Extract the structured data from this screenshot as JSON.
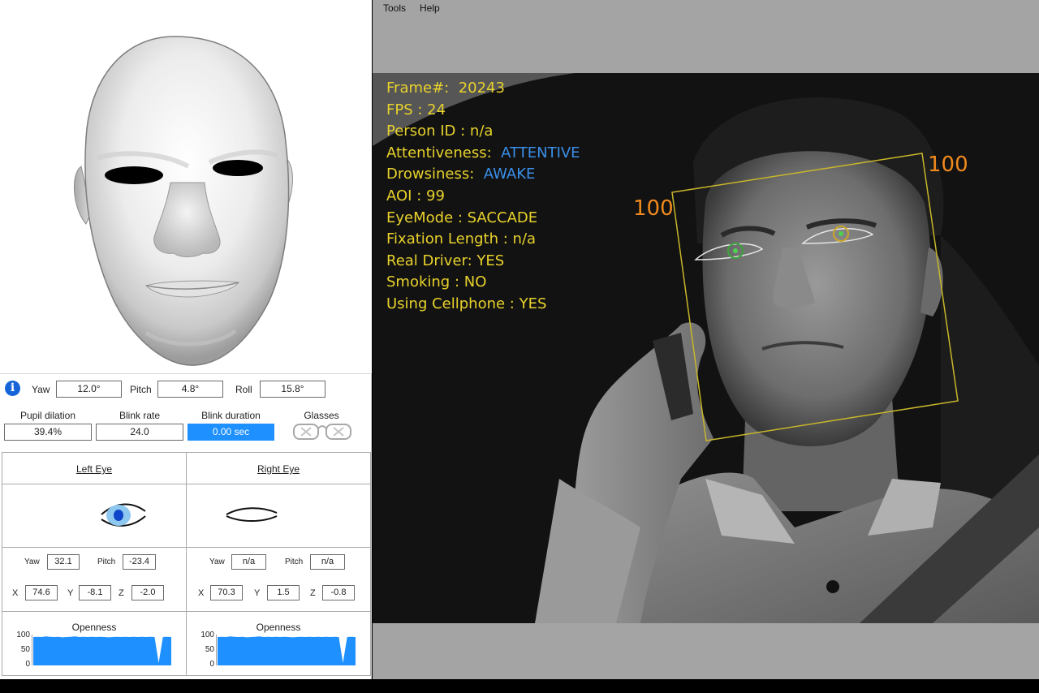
{
  "menu": {
    "tools": "Tools",
    "help": "Help"
  },
  "head_pose": {
    "yaw_label": "Yaw",
    "yaw": "12.0°",
    "pitch_label": "Pitch",
    "pitch": "4.8°",
    "roll_label": "Roll",
    "roll": "15.8°"
  },
  "metrics": {
    "pupil_label": "Pupil dilation",
    "pupil": "39.4%",
    "blink_rate_label": "Blink rate",
    "blink_rate": "24.0",
    "blink_duration_label": "Blink duration",
    "blink_duration": "0.00 sec",
    "glasses_label": "Glasses"
  },
  "left_eye": {
    "title": "Left  Eye",
    "yaw_label": "Yaw",
    "yaw": "32.1",
    "pitch_label": "Pitch",
    "pitch": "-23.4",
    "x_label": "X",
    "x": "74.6",
    "y_label": "Y",
    "y": "-8.1",
    "z_label": "Z",
    "z": "-2.0",
    "openness_title": "Openness",
    "openness_ticks": [
      "100",
      "50",
      "0"
    ],
    "openness_series": [
      92,
      93,
      92,
      94,
      93,
      92,
      93,
      91,
      92,
      93,
      94,
      92,
      93,
      92,
      93,
      92,
      93,
      92,
      91,
      92,
      93,
      92,
      93,
      92,
      93,
      92,
      93,
      92,
      93,
      92,
      8,
      92,
      93,
      92
    ],
    "state": "open"
  },
  "right_eye": {
    "title": "Right  Eye",
    "yaw_label": "Yaw",
    "yaw": "n/a",
    "pitch_label": "Pitch",
    "pitch": "n/a",
    "x_label": "X",
    "x": "70.3",
    "y_label": "Y",
    "y": "1.5",
    "z_label": "Z",
    "z": "-0.8",
    "openness_title": "Openness",
    "openness_ticks": [
      "100",
      "50",
      "0"
    ],
    "openness_series": [
      92,
      93,
      92,
      94,
      93,
      92,
      93,
      91,
      92,
      93,
      94,
      92,
      93,
      92,
      93,
      92,
      93,
      92,
      91,
      92,
      93,
      92,
      93,
      92,
      93,
      92,
      93,
      92,
      93,
      92,
      8,
      92,
      93,
      92
    ],
    "state": "closed"
  },
  "overlay": {
    "frame_label": "Frame#:",
    "frame": "20243",
    "fps_label": "FPS :",
    "fps": "24",
    "person_label": "Person ID :",
    "person": "n/a",
    "attentiveness_label": "Attentiveness:",
    "attentiveness": "ATTENTIVE",
    "drowsiness_label": "Drowsiness:",
    "drowsiness": "AWAKE",
    "aoi_label": "AOI :",
    "aoi": "99",
    "eyemode_label": "EyeMode :",
    "eyemode": "SACCADE",
    "fixation_label": "Fixation Length :",
    "fixation": "n/a",
    "real_driver_label": "Real Driver:",
    "real_driver": "YES",
    "smoking_label": "Smoking :",
    "smoking": "NO",
    "cellphone_label": "Using Cellphone :",
    "cellphone": "YES",
    "box_label_left": "100",
    "box_label_right": "100"
  },
  "colors": {
    "accent": "#1e90ff",
    "overlay_text": "#e8d22c",
    "overlay_status": "#3a8fe8",
    "box_label": "#f08a1c",
    "face_box": "#c9b62a",
    "eye_iris": "#3aa43a"
  }
}
